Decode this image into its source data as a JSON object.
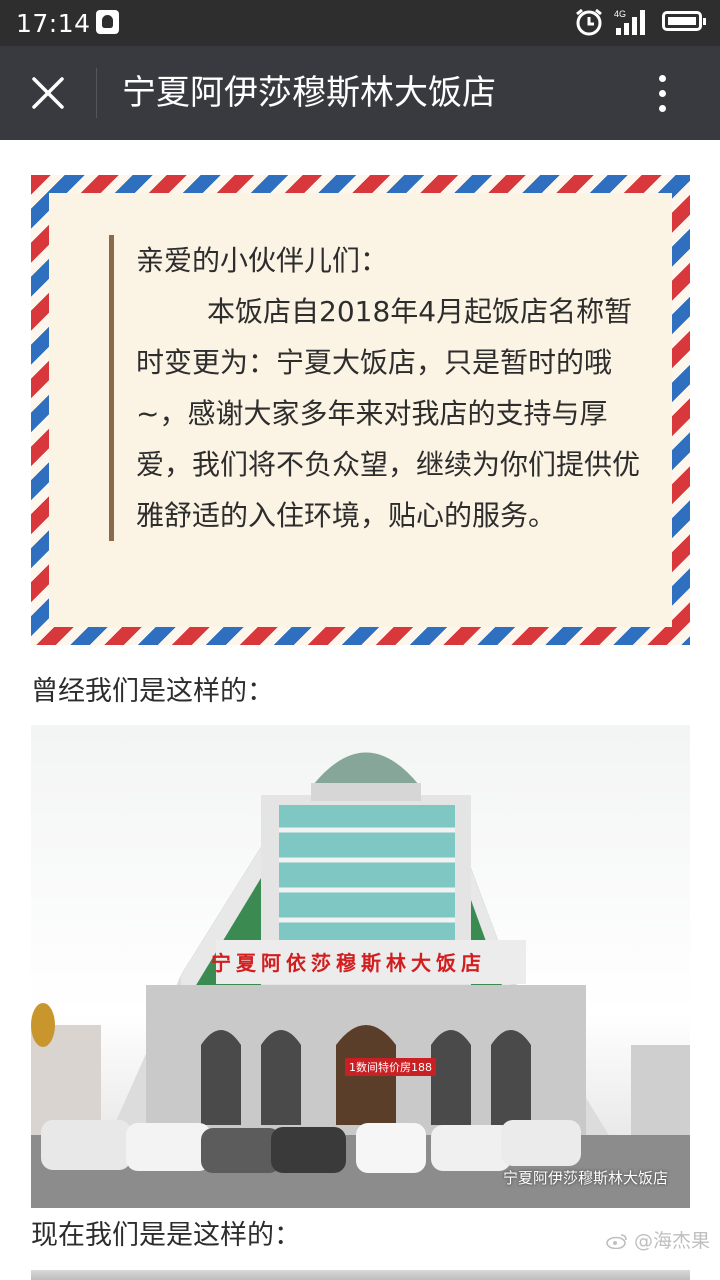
{
  "status_bar": {
    "time": "17:14",
    "network": "4G",
    "icons": [
      "notification-icon",
      "alarm-icon",
      "signal-icon",
      "battery-icon"
    ]
  },
  "nav": {
    "title": "宁夏阿伊莎穆斯林大饭店",
    "close_icon": "close-icon",
    "more_icon": "more-vertical-icon"
  },
  "letter": {
    "greeting": "亲爱的小伙伴儿们：",
    "body": "本饭店自2018年4月起饭店名称暂时变更为：宁夏大饭店，只是暂时的哦~，感谢大家多年来对我店的支持与厚爱，我们将不负众望，继续为你们提供优雅舒适的入住环境，贴心的服务。",
    "colors": {
      "red": "#d8373c",
      "blue": "#2f6fbf",
      "paper": "#fbf3e4"
    }
  },
  "section1": {
    "caption": "曾经我们是这样的：",
    "photo": {
      "sign_text": "宁夏阿依莎穆斯林大饭店",
      "banner_text": "1数间特价房188",
      "watermark": "宁夏阿伊莎穆斯林大饭店"
    }
  },
  "section2": {
    "caption": "现在我们是是这样的："
  },
  "weibo_watermark": "@海杰果"
}
